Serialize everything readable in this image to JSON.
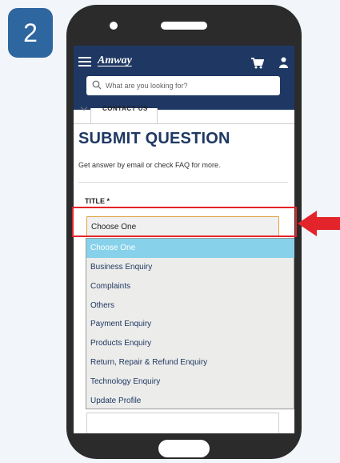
{
  "step": {
    "number": "2"
  },
  "header": {
    "brand": "Amway",
    "search_placeholder": "What are you looking for?",
    "icons": [
      "menu-icon",
      "cart-icon",
      "user-icon",
      "search-icon"
    ]
  },
  "tabs": {
    "active_label": "CONTACT US"
  },
  "page": {
    "title": "SUBMIT QUESTION",
    "subtitle": "Get answer by email or check FAQ for more."
  },
  "form": {
    "title_label": "TITLE *",
    "title_value": "Choose One",
    "options": [
      "Choose One",
      "Business Enquiry",
      "Complaints",
      "Others",
      "Payment Enquiry",
      "Products Enquiry",
      "Return, Repair & Refund Enquiry",
      "Technology Enquiry",
      "Update Profile"
    ],
    "selected_index": 0
  },
  "colors": {
    "header_bg": "#1f3863",
    "highlight": "#e3242b",
    "selected_option_bg": "#87d2ea",
    "badge_bg": "#2e66a0"
  }
}
